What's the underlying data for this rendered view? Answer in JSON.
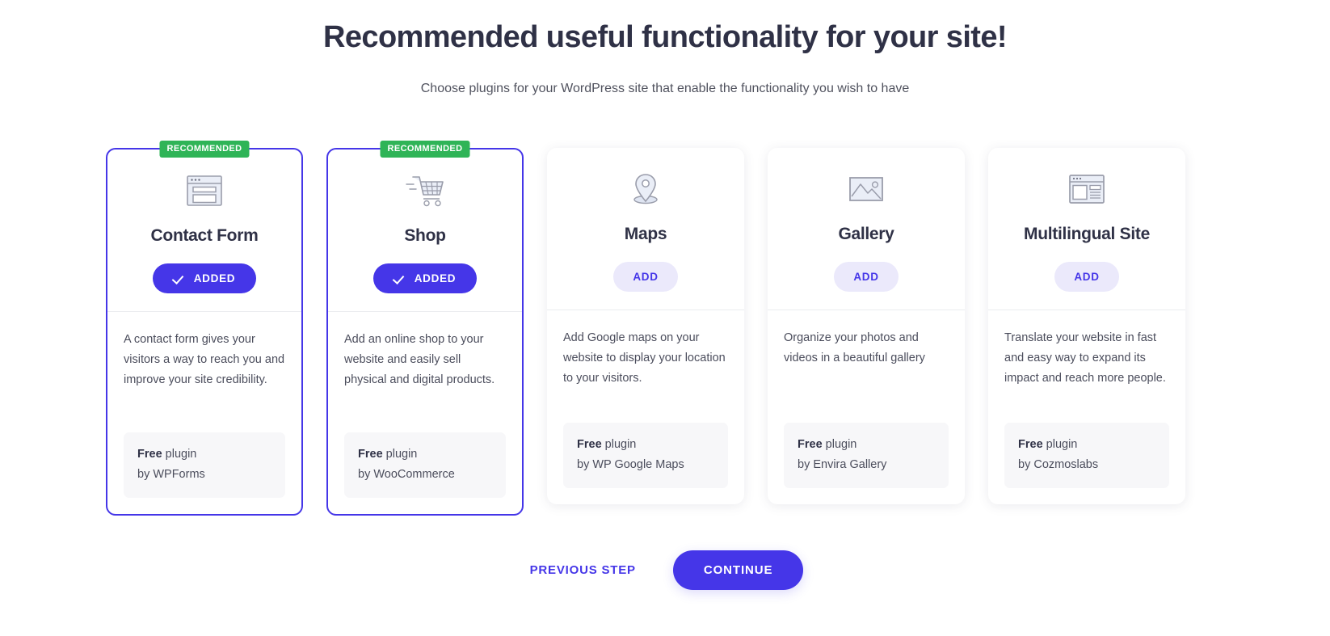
{
  "header": {
    "title": "Recommended useful functionality for your site!",
    "subtitle": "Choose plugins for your WordPress site that enable the functionality you wish to have"
  },
  "colors": {
    "accent": "#4536e8",
    "badge_green": "#2fb457",
    "add_button_bg": "#ebe9fb",
    "plugin_box_bg": "#f7f7f9",
    "title_text": "#2f3146",
    "body_text": "#4b4d5c"
  },
  "cards": [
    {
      "badge": "RECOMMENDED",
      "icon": "browser-form-icon",
      "title": "Contact Form",
      "button_label": "ADDED",
      "button_state": "added",
      "description": "A contact form gives your visitors a way to reach you and improve your site credibility.",
      "plugin_price": "Free",
      "plugin_word": " plugin",
      "plugin_author": "by WPForms",
      "selected": true
    },
    {
      "badge": "RECOMMENDED",
      "icon": "shopping-cart-icon",
      "title": "Shop",
      "button_label": "ADDED",
      "button_state": "added",
      "description": "Add an online shop to your website and easily sell physical and digital products.",
      "plugin_price": "Free",
      "plugin_word": " plugin",
      "plugin_author": "by WooCommerce",
      "selected": true
    },
    {
      "badge": "",
      "icon": "map-pin-icon",
      "title": "Maps",
      "button_label": "ADD",
      "button_state": "add",
      "description": "Add Google maps on your website to display your location to your visitors.",
      "plugin_price": "Free",
      "plugin_word": " plugin",
      "plugin_author": "by WP Google Maps",
      "selected": false
    },
    {
      "badge": "",
      "icon": "image-gallery-icon",
      "title": "Gallery",
      "button_label": "ADD",
      "button_state": "add",
      "description": "Organize your photos and videos in a beautiful gallery",
      "plugin_price": "Free",
      "plugin_word": " plugin",
      "plugin_author": "by Envira Gallery",
      "selected": false
    },
    {
      "badge": "",
      "icon": "layout-page-icon",
      "title": "Multilingual Site",
      "button_label": "ADD",
      "button_state": "add",
      "description": "Translate your website in fast and easy way to expand its impact and reach more people.",
      "plugin_price": "Free",
      "plugin_word": " plugin",
      "plugin_author": "by Cozmoslabs",
      "selected": false
    }
  ],
  "footer": {
    "previous_label": "PREVIOUS STEP",
    "continue_label": "CONTINUE"
  }
}
